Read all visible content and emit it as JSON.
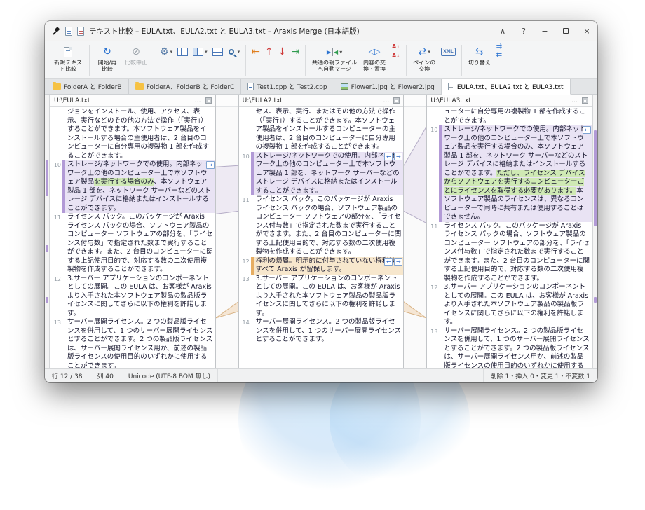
{
  "window": {
    "title": "テキスト比較 – EULA.txt、EULA2.txt と EULA3.txt – Araxis Merge (日本語版)",
    "controls": {
      "collapse": "∧",
      "help": "?",
      "minimize": "−",
      "close": "×"
    }
  },
  "toolbar": {
    "new_text": "新規テキスト比較",
    "start": "開始/再比較",
    "abort": "比較中止",
    "auto_merge": "共通の親ファイルへ自動マージ",
    "swap_replace": "内容の交換・置換",
    "pane_swap": "ペインの交換",
    "toggle": "切り替え",
    "xml_label": "XML"
  },
  "ui": {
    "ellipsis": "…"
  },
  "tabs": [
    {
      "label": "FolderA と FolderB",
      "icon": "folder-pair-icon",
      "active": false
    },
    {
      "label": "FolderA、FolderB と FolderC",
      "icon": "folder-pair-icon",
      "active": false
    },
    {
      "label": "Test1.cpp と Test2.cpp",
      "icon": "code-file-icon",
      "active": false
    },
    {
      "label": "Flower1.jpg と Flower2.jpg",
      "icon": "image-file-icon",
      "active": false
    },
    {
      "label": "EULA.txt、EULA2.txt と EULA3.txt",
      "icon": "text-file-icon",
      "active": true
    }
  ],
  "panes": [
    {
      "path": "U:\\EULA.txt",
      "rows": [
        {
          "num": "",
          "type": "plain",
          "segments": [
            {
              "text": "ジョンをインストール、使用、アクセス、表示、実行などのその他の方法で操作（「実行」）することができます。本ソフトウェア製品をインストールする場合の主使用者は、2 台目のコンピューターに自分専用の複製物 1 部を作成することができます。"
            }
          ]
        },
        {
          "num": "10",
          "type": "changed",
          "buttons": [
            "right"
          ],
          "segments": [
            {
              "text": "ストレージ/ネットワークでの使用。内部ネットワーク上の他のコンピューター上で本ソフトウェア製品"
            },
            {
              "text": "を実行する場合のみ",
              "hl": "green"
            },
            {
              "text": "、本ソフトウェア製品 1 部を、ネットワーク サーバーなどのストレージ デバイスに格納またはインストールすることができます。"
            }
          ]
        },
        {
          "num": "11",
          "type": "plain",
          "segments": [
            {
              "text": "ライセンス パック。このパッケージが Araxis ライセンス パックの場合、ソフトウェア製品のコンピューター ソフトウェアの部分を、「ライセンス付与数」で指定された数まで実行することができます。また、2 台目のコンピューターに関する上記使用目的で、対応する数の二次使用複製物を作成することができます。"
            }
          ]
        },
        {
          "num": "12",
          "type": "plain",
          "segments": [
            {
              "text": "3.サーバー アプリケーションのコンポーネントとしての展開。この EULA は、お客様が Araxis より入手された本ソフトウェア製品の製品版ライセンスに関してさらに以下の権利を許諾します。"
            }
          ]
        },
        {
          "num": "13",
          "type": "plain",
          "segments": [
            {
              "text": "サーバー展開ライセンス。2 つの製品版ライセンスを併用して、1 つのサーバー展開ライセンスとすることができます。2 つの製品版ライセンスは、サーバー展開ライセンス用か、前述の製品版ライセンスの使用目的のいずれかに使用することができます。"
            }
          ]
        }
      ]
    },
    {
      "path": "U:\\EULA2.txt",
      "rows": [
        {
          "num": "",
          "type": "plain",
          "segments": [
            {
              "text": "セス、表示、実行、またはその他の方法で操作（「実行」）することができます。本ソフトウェア製品をインストールするコンピューターの主使用者は、2 台目のコンピューターに自分専用の複製物 1 部を作成することができます。"
            }
          ]
        },
        {
          "num": "10",
          "type": "changed",
          "buttons": [
            "left",
            "right"
          ],
          "segments": [
            {
              "text": "ストレージ/ネットワークでの使用。内部ネットワーク上の他のコンピューター上で本ソフトウェア製品 1 部を、ネットワーク サーバーなどのストレージ デバイスに格納またはインストールすることができます。"
            }
          ]
        },
        {
          "num": "11",
          "type": "plain",
          "segments": [
            {
              "text": "ライセンス パック。このパッケージが Araxis ライセンス パックの場合、ソフトウェア製品のコンピューター ソフトウェアの部分を、「ライセンス付与数」で指定された数まで実行することができます。また、2 台目のコンピューターに関する上記使用目的で、対応する数の二次使用複製物を作成することができます。"
            }
          ]
        },
        {
          "num": "12",
          "type": "deleted",
          "buttons": [
            "left",
            "right"
          ],
          "segments": [
            {
              "text": "権利の帰属。明示的に付与されていない権利はすべて Araxis が留保します。"
            }
          ]
        },
        {
          "num": "13",
          "type": "plain",
          "segments": [
            {
              "text": "3.サーバー アプリケーションのコンポーネントとしての展開。この EULA は、お客様が Araxis より入手された本ソフトウェア製品の製品版ライセンスに関してさらに以下の権利を許諾します。"
            }
          ]
        },
        {
          "num": "14",
          "type": "plain",
          "segments": [
            {
              "text": "サーバー展開ライセンス。2 つの製品版ライセンスを併用して、1 つのサーバー展開ライセンスとすることができます。"
            }
          ]
        }
      ]
    },
    {
      "path": "U:\\EULA3.txt",
      "rows": [
        {
          "num": "",
          "type": "plain",
          "segments": [
            {
              "text": "ューターに自分専用の複製物 1 部を作成することができます。"
            }
          ]
        },
        {
          "num": "10",
          "type": "changed",
          "buttons": [
            "left"
          ],
          "segments": [
            {
              "text": "ストレージ/ネットワークでの使用。内部ネットワーク上の他のコンピューター上で本ソフトウェア製品を実行する場合のみ、本ソフトウェア製品 1 部を、ネットワーク サーバーなどのストレージ デバイスに格納またはインストールすることができます。"
            },
            {
              "text": "ただし、ライセンス デバイスからソフトウェアを実行するコンピューターごとにライセンスを取得する必要があります。",
              "hl": "green"
            },
            {
              "text": "本ソフトウェア製品のライセンスは、異なるコンピューターで同時に共有または使用することはできません。"
            }
          ]
        },
        {
          "num": "11",
          "type": "plain",
          "segments": [
            {
              "text": "ライセンス パック。このパッケージが Araxis ライセンス パックの場合、ソフトウェア製品のコンピューター ソフトウェアの部分を、「ライセンス付与数」で指定された数まで実行することができます。また、2 台目のコンピューターに関する上記使用目的で、対応する数の二次使用複製物を作成することができます。"
            }
          ]
        },
        {
          "num": "12",
          "type": "plain",
          "segments": [
            {
              "text": "3.サーバー アプリケーションのコンポーネントとしての展開。この EULA は、お客様が Araxis より入手された本ソフトウェア製品の製品版ライセンスに関してさらに以下の権利を許諾します。"
            }
          ]
        },
        {
          "num": "13",
          "type": "plain",
          "segments": [
            {
              "text": "サーバー展開ライセンス。2 つの製品版ライセンスを併用して、1 つのサーバー展開ライセンスとすることができます。2 つの製品版ライセンスは、サーバー展開ライセンス用か、前述の製品版ライセンスの使用目的のいずれかに使用することができます。"
            }
          ]
        }
      ]
    }
  ],
  "status": {
    "line": "行 12 / 38",
    "column": "列 40",
    "encoding": "Unicode (UTF-8 BOM 無し)",
    "summary": "削除 1・挿入 0・変更 1・不変数 1"
  },
  "colors": {
    "diff_changed_bg": "#e9e3f4",
    "diff_inserted_bg": "#cfe9b4",
    "diff_deleted_bg": "#f7e7cd",
    "marker_changed": "#b29ad6",
    "marker_deleted": "#e6ad62"
  }
}
